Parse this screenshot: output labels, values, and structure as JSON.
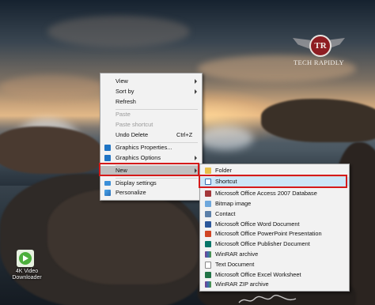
{
  "watermark": {
    "initials": "TR",
    "text": "TECH RAPIDLY"
  },
  "context_menu": {
    "items": [
      {
        "label": "View",
        "submenu": true
      },
      {
        "label": "Sort by",
        "submenu": true
      },
      {
        "label": "Refresh"
      },
      {
        "label": "Paste",
        "disabled": true
      },
      {
        "label": "Paste shortcut",
        "disabled": true
      },
      {
        "label": "Undo Delete",
        "shortcut": "Ctrl+Z"
      },
      {
        "label": "Graphics Properties..."
      },
      {
        "label": "Graphics Options",
        "submenu": true
      },
      {
        "label": "New",
        "submenu": true,
        "highlighted": true
      },
      {
        "label": "Display settings"
      },
      {
        "label": "Personalize"
      }
    ]
  },
  "new_submenu": {
    "items": [
      {
        "label": "Folder"
      },
      {
        "label": "Shortcut",
        "highlighted": true
      },
      {
        "label": "Microsoft Office Access 2007 Database"
      },
      {
        "label": "Bitmap image"
      },
      {
        "label": "Contact"
      },
      {
        "label": "Microsoft Office Word Document"
      },
      {
        "label": "Microsoft Office PowerPoint Presentation"
      },
      {
        "label": "Microsoft Office Publisher Document"
      },
      {
        "label": "WinRAR archive"
      },
      {
        "label": "Text Document"
      },
      {
        "label": "Microsoft Office Excel Worksheet"
      },
      {
        "label": "WinRAR ZIP archive"
      }
    ]
  },
  "desktop_icon": {
    "label_line1": "4K Video",
    "label_line2": "Downloader"
  },
  "colors": {
    "highlight_box": "#d51a1a",
    "menu_bg": "#f2f2f2",
    "hover": "#cde6f7"
  }
}
